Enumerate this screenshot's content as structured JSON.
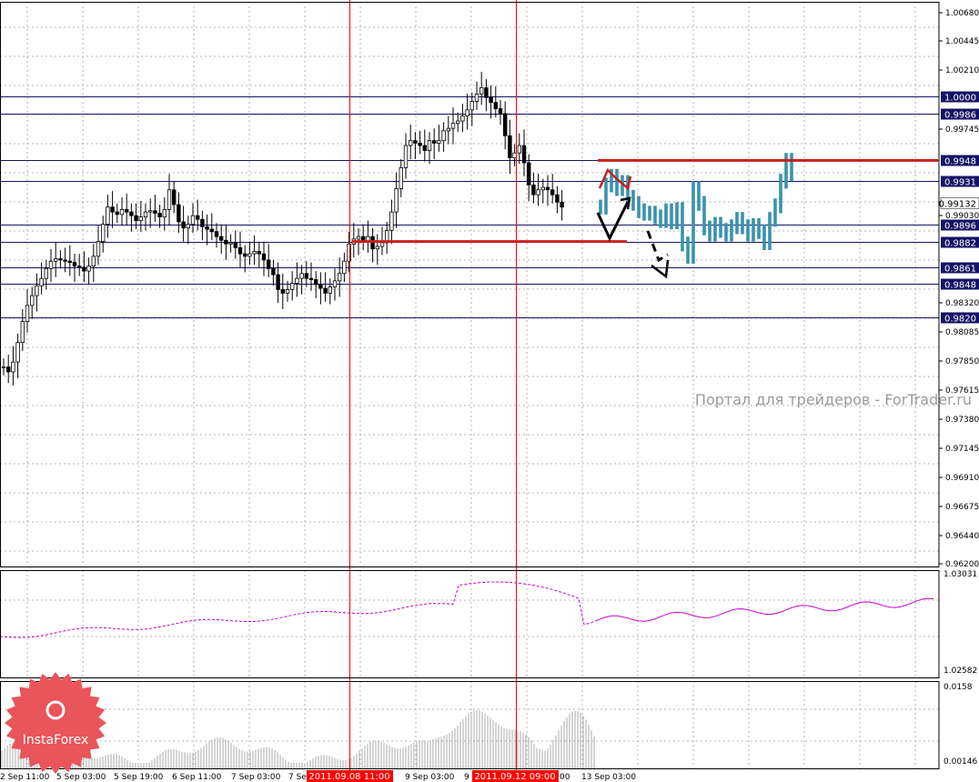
{
  "watermark": "Портал для трейдеров - ForTrader.ru",
  "logo": {
    "text": "InstaForex"
  },
  "colors": {
    "background": "#ffffff",
    "grid": "#b4b4b4",
    "candle": "#000000",
    "forecast": "#3a92ad",
    "level_line": "#141464",
    "resistance": "#c81e1e",
    "marker": "#ff0000",
    "indicator": "#c800c8",
    "histogram": "#a8a8a8"
  },
  "main_axis": {
    "ticks": [
      "1.00680",
      "1.00445",
      "1.00210",
      "0.99745",
      "0.99030",
      "0.98320",
      "0.98085",
      "0.97850",
      "0.97615",
      "0.97380",
      "0.97145",
      "0.96910",
      "0.96675",
      "0.96440",
      "0.96200"
    ],
    "current_price": "0.99132"
  },
  "levels": [
    {
      "label": "1.0000",
      "value": 1.0
    },
    {
      "label": "0.9986",
      "value": 0.9986
    },
    {
      "label": "0.9948",
      "value": 0.9948
    },
    {
      "label": "0.9931",
      "value": 0.9931
    },
    {
      "label": "0.9896",
      "value": 0.9896
    },
    {
      "label": "0.9882",
      "value": 0.9882
    },
    {
      "label": "0.9861",
      "value": 0.9861
    },
    {
      "label": "0.9848",
      "value": 0.9848
    },
    {
      "label": "0.9820",
      "value": 0.982
    }
  ],
  "x_axis": {
    "labels": [
      "2 Sep 11:00",
      "5 Sep 03:00",
      "5 Sep 19:00",
      "6 Sep 11:00",
      "7 Sep 03:00",
      "7 Se",
      "9 Sep 03:00",
      "9",
      ":00",
      "13 Sep 03:00"
    ],
    "markers": [
      "2011.09.08 11:00",
      "2011.09.12 09:00"
    ]
  },
  "indicator_axis": {
    "ticks": [
      "1.03031",
      "1.02582"
    ]
  },
  "histogram_axis": {
    "ticks": [
      "0.0158",
      "0.00146"
    ]
  },
  "chart_data": {
    "type": "candlestick",
    "title": "",
    "ylim": [
      0.962,
      1.0068
    ],
    "horizontal_levels": [
      1.0,
      0.9986,
      0.9948,
      0.9931,
      0.9896,
      0.9882,
      0.9861,
      0.9848,
      0.982
    ],
    "resistance_lines": [
      0.9948,
      0.9882
    ],
    "vertical_markers": [
      "2011.09.08 11:00",
      "2011.09.12 09:00"
    ],
    "closes": [
      0.978,
      0.9776,
      0.9784,
      0.98,
      0.9817,
      0.983,
      0.9838,
      0.9846,
      0.9852,
      0.986,
      0.9866,
      0.9868,
      0.9867,
      0.9866,
      0.9865,
      0.9862,
      0.9861,
      0.9858,
      0.9862,
      0.987,
      0.9882,
      0.9896,
      0.991,
      0.9906,
      0.9904,
      0.9908,
      0.9906,
      0.9903,
      0.9899,
      0.9902,
      0.9906,
      0.9907,
      0.9905,
      0.9902,
      0.9908,
      0.9924,
      0.9912,
      0.9898,
      0.9893,
      0.9896,
      0.9903,
      0.99,
      0.9894,
      0.9892,
      0.989,
      0.9886,
      0.9883,
      0.988,
      0.9881,
      0.9877,
      0.9872,
      0.987,
      0.9872,
      0.9874,
      0.9872,
      0.9867,
      0.986,
      0.9855,
      0.9843,
      0.984,
      0.9843,
      0.9848,
      0.9852,
      0.9856,
      0.9852,
      0.9851,
      0.9847,
      0.9844,
      0.984,
      0.9845,
      0.985,
      0.9856,
      0.9866,
      0.988,
      0.9884,
      0.9886,
      0.9882,
      0.9886,
      0.9876,
      0.9878,
      0.9881,
      0.9891,
      0.9906,
      0.9925,
      0.9942,
      0.996,
      0.9964,
      0.9962,
      0.996,
      0.9956,
      0.9964,
      0.9962,
      0.9964,
      0.9972,
      0.9974,
      0.9978,
      0.998,
      0.9984,
      0.9989,
      0.9996,
      1.0002,
      1.0007,
      0.9999,
      0.9995,
      0.999,
      0.9986,
      0.9968,
      0.995,
      0.9954,
      0.996,
      0.9946,
      0.9928,
      0.992,
      0.9924,
      0.9926,
      0.9924,
      0.992,
      0.9914,
      0.991
    ],
    "forecast": [
      0.991,
      0.9928,
      0.9935,
      0.9925,
      0.993,
      0.9918,
      0.9913,
      0.9907,
      0.9905,
      0.9905,
      0.9902,
      0.9899,
      0.9907,
      0.9898,
      0.9908,
      0.988,
      0.987,
      0.9925,
      0.9913,
      0.9893,
      0.9888,
      0.9896,
      0.9891,
      0.9888,
      0.9894,
      0.99,
      0.9894,
      0.9888,
      0.9895,
      0.989,
      0.9881,
      0.99,
      0.9911,
      0.9931,
      0.9948,
      0.9937
    ]
  }
}
